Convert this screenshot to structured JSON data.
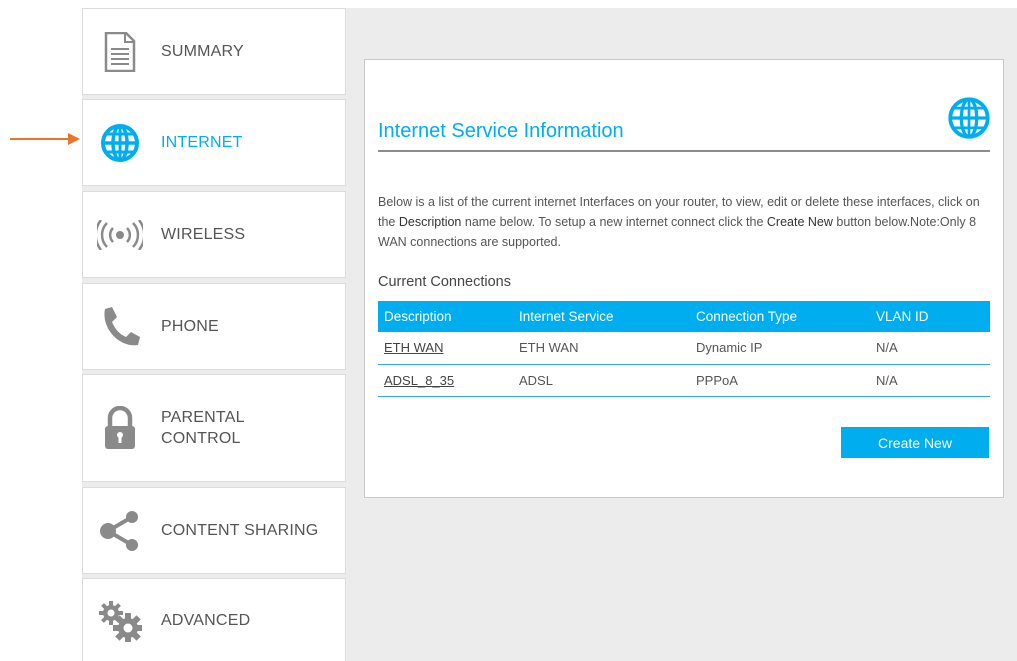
{
  "sidebar": {
    "items": [
      {
        "label": "SUMMARY",
        "icon": "document-icon",
        "active": false
      },
      {
        "label": "INTERNET",
        "icon": "globe-icon",
        "active": true
      },
      {
        "label": "WIRELESS",
        "icon": "wireless-signal-icon",
        "active": false
      },
      {
        "label": "PHONE",
        "icon": "phone-icon",
        "active": false
      },
      {
        "label": "PARENTAL\nCONTROL",
        "icon": "lock-icon",
        "active": false
      },
      {
        "label": "CONTENT SHARING",
        "icon": "share-icon",
        "active": false
      },
      {
        "label": "ADVANCED",
        "icon": "gears-icon",
        "active": false
      }
    ]
  },
  "panel": {
    "title": "Internet Service Information",
    "description": {
      "part1": "Below is a list of the current internet Interfaces on your router, to view, edit or delete these interfaces, click on the ",
      "bold1": "Description",
      "part2": " name below. To setup a new internet connect click the ",
      "bold2": "Create New",
      "part3": " button below.Note:Only 8 WAN connections are supported."
    },
    "section_title": "Current Connections",
    "table": {
      "headers": [
        "Description",
        "Internet Service",
        "Connection Type",
        "VLAN ID"
      ],
      "rows": [
        [
          "ETH WAN",
          "ETH WAN",
          "Dynamic IP",
          "N/A"
        ],
        [
          "ADSL_8_35",
          "ADSL",
          "PPPoA",
          "N/A"
        ]
      ]
    },
    "create_button": "Create New"
  },
  "colors": {
    "accent": "#00aeef",
    "arrow": "#e8752a",
    "icon_gray": "#8a8a8a"
  }
}
